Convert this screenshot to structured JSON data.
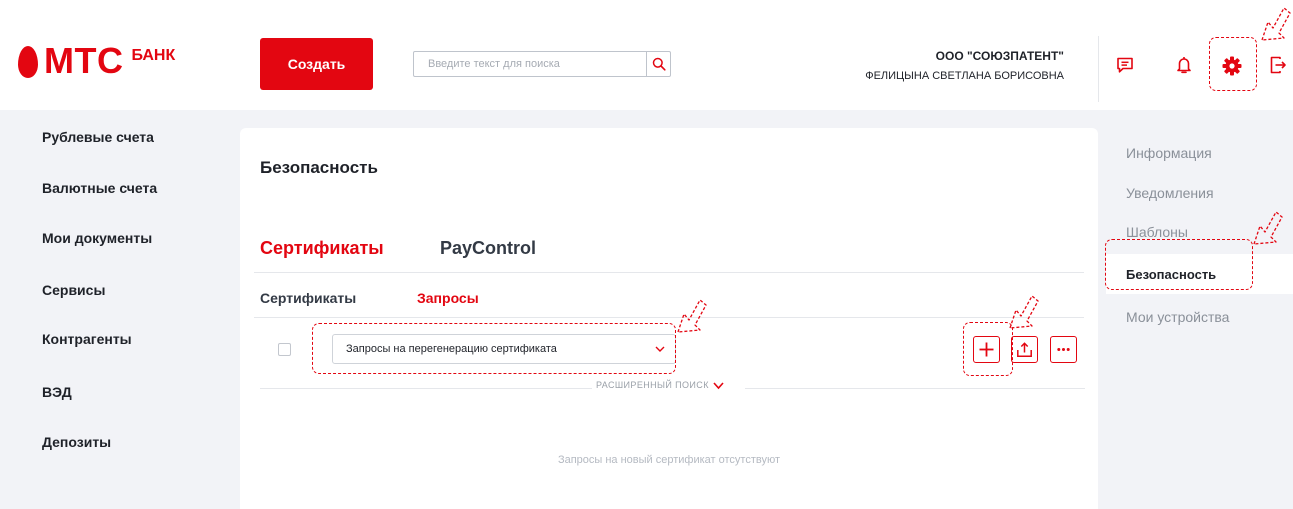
{
  "logo": {
    "brand": "МТС",
    "suffix": "БАНК"
  },
  "header": {
    "create_label": "Создать",
    "search": {
      "placeholder": "Введите текст для поиска",
      "value": ""
    },
    "company_name": "ООО \"СОЮЗПАТЕНТ\"",
    "user_name": "ФЕЛИЦЫНА СВЕТЛАНА БОРИСОВНА",
    "icons": [
      "chat-icon",
      "bell-icon",
      "gear-icon",
      "logout-icon"
    ]
  },
  "sidebar": {
    "items": [
      {
        "label": "Рублевые счета"
      },
      {
        "label": "Валютные счета"
      },
      {
        "label": "Мои документы"
      },
      {
        "label": "Сервисы"
      },
      {
        "label": "Контрагенты"
      },
      {
        "label": "ВЭД"
      },
      {
        "label": "Депозиты"
      }
    ]
  },
  "main": {
    "title": "Безопасность",
    "tabs": [
      {
        "label": "Сертификаты",
        "active": true
      },
      {
        "label": "PayControl",
        "active": false
      }
    ],
    "subtabs": [
      {
        "label": "Сертификаты",
        "active": false
      },
      {
        "label": "Запросы",
        "active": true
      }
    ],
    "filter": {
      "selected": "Запросы на перегенерацию сертификата"
    },
    "actions": [
      "add-icon",
      "upload-icon",
      "more-icon"
    ],
    "advanced_search_label": "РАСШИРЕННЫЙ ПОИСК",
    "empty_message": "Запросы на новый сертификат отсутствуют"
  },
  "right_nav": {
    "items": [
      {
        "label": "Информация",
        "active": false
      },
      {
        "label": "Уведомления",
        "active": false
      },
      {
        "label": "Шаблоны",
        "active": false
      },
      {
        "label": "Безопасность",
        "active": true
      },
      {
        "label": "Мои устройства",
        "active": false
      }
    ]
  },
  "colors": {
    "accent": "#e30611",
    "text": "#1f2229",
    "muted": "#8a9099",
    "background": "#f2f3f7"
  }
}
